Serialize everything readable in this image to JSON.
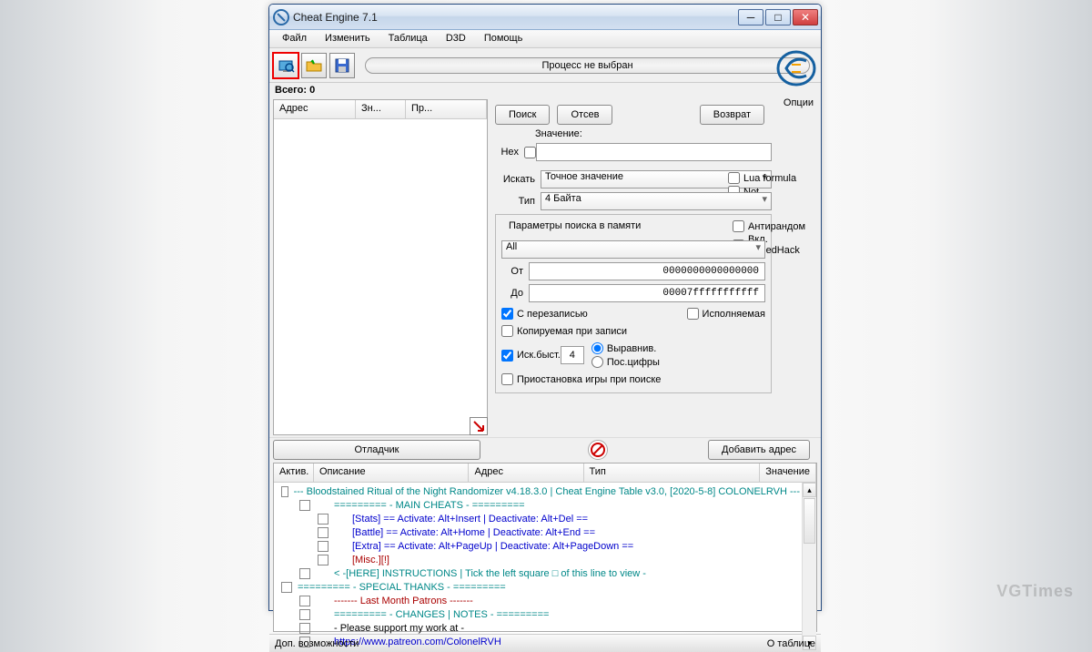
{
  "window": {
    "title": "Cheat Engine 7.1"
  },
  "menu": [
    "Файл",
    "Изменить",
    "Таблица",
    "D3D",
    "Помощь"
  ],
  "process_label": "Процесс не выбран",
  "total_label": "Всего:",
  "total_value": "0",
  "options_label": "Опции",
  "cols": {
    "addr": "Адрес",
    "val": "Зн...",
    "prev": "Пр..."
  },
  "buttons": {
    "search": "Поиск",
    "filter": "Отсев",
    "back": "Возврат",
    "debugger": "Отладчик",
    "addaddr": "Добавить адрес"
  },
  "labels": {
    "value": "Значение:",
    "hex": "Hex",
    "scan": "Искать",
    "type": "Тип",
    "memparams": "Параметры поиска в памяти",
    "from": "От",
    "to": "До"
  },
  "scan_type": "Точное значение",
  "value_type": "4 Байта",
  "region": "All",
  "from": "0000000000000000",
  "to": "00007fffffffffff",
  "checks": {
    "lua": "Lua formula",
    "not": "Not",
    "antirandom": "Антирандом",
    "speedhack": "Вкл. SpeedHack",
    "rewrite": "С перезаписью",
    "exec": "Исполняемая",
    "copyonwrite": "Копируемая при записи",
    "fast": "Иск.быст.",
    "align": "Выравнив.",
    "digits": "Пос.цифры",
    "pause": "Приостановка игры при поиске"
  },
  "fastval": "4",
  "bottom_cols": [
    "Актив.",
    "Описание",
    "Адрес",
    "Тип",
    "Значение"
  ],
  "table": [
    {
      "ind": 0,
      "color": "teal",
      "text": "--- Bloodstained Ritual of the Night Randomizer v4.18.3.0 | Cheat Engine Table v3.0, [2020-5-8] COLONELRVH ---"
    },
    {
      "ind": 1,
      "color": "teal",
      "text": "=========    - MAIN CHEATS -             ========="
    },
    {
      "ind": 2,
      "color": "blue",
      "text": "[Stats]   == Activate: Alt+Insert    | Deactivate: Alt+Del          =="
    },
    {
      "ind": 2,
      "color": "blue",
      "text": "[Battle] == Activate: Alt+Home    | Deactivate: Alt+End         =="
    },
    {
      "ind": 2,
      "color": "blue",
      "text": "[Extra]   == Activate: Alt+PageUp | Deactivate: Alt+PageDown =="
    },
    {
      "ind": 2,
      "color": "red",
      "text": "[Misc.][!]"
    },
    {
      "ind": 1,
      "color": "teal",
      "text": "< -[HERE] INSTRUCTIONS | Tick the left square □ of this line to view -"
    },
    {
      "ind": 0,
      "color": "teal",
      "text": "=========    - SPECIAL THANKS -        ========="
    },
    {
      "ind": 1,
      "color": "red",
      "text": "-------             Last Month Patrons               -------"
    },
    {
      "ind": 1,
      "color": "teal",
      "text": "=========    - CHANGES | NOTES -      ========="
    },
    {
      "ind": 1,
      "color": "",
      "text": "- Please support my work at -"
    },
    {
      "ind": 1,
      "color": "blue",
      "text": "https://www.patreon.com/ColonelRVH"
    }
  ],
  "status": {
    "left": "Доп. возможности",
    "right": "О таблице"
  },
  "watermark": "VGTimes"
}
